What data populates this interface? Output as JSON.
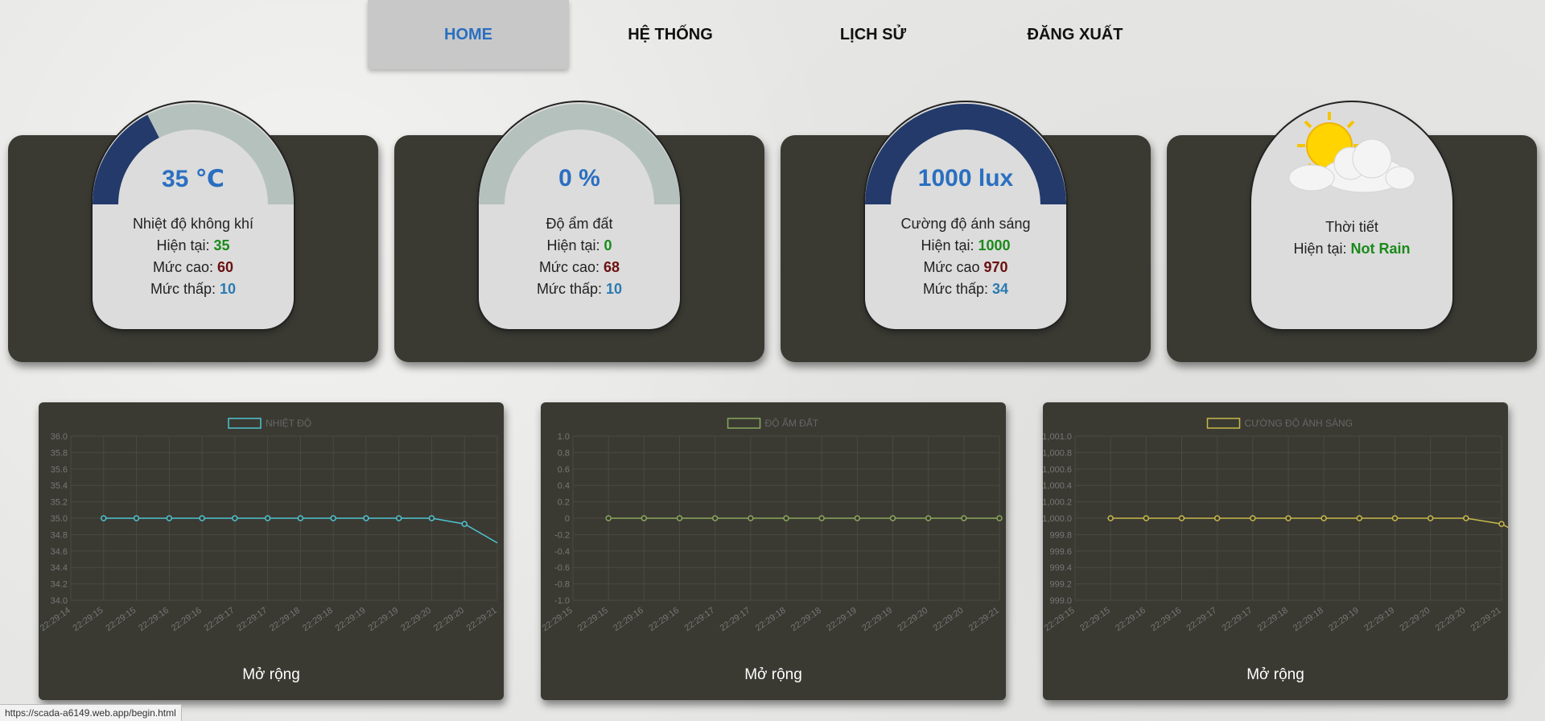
{
  "nav": {
    "items": [
      {
        "label": "HOME",
        "active": true
      },
      {
        "label": "HỆ THỐNG",
        "active": false
      },
      {
        "label": "LỊCH SỬ",
        "active": false
      },
      {
        "label": "ĐĂNG XUẤT",
        "active": false
      }
    ]
  },
  "cards": {
    "temperature": {
      "value_text": "35 ℃",
      "fraction": 0.35,
      "title": "Nhiệt độ không khí",
      "now_label": "Hiện tại: ",
      "now": "35",
      "high_label": "Mức cao: ",
      "high": "60",
      "low_label": "Mức thấp: ",
      "low": "10"
    },
    "soil": {
      "value_text": "0 %",
      "fraction": 0.0,
      "title": "Độ ẩm đất",
      "now_label": "Hiện tại: ",
      "now": "0",
      "high_label": "Mức cao: ",
      "high": "68",
      "low_label": "Mức thấp: ",
      "low": "10"
    },
    "light": {
      "value_text": "1000 lux",
      "fraction": 1.0,
      "title": "Cường độ ánh sáng",
      "now_label": "Hiện tại: ",
      "now": "1000",
      "high_label": "Mức cao ",
      "high": "970",
      "low_label": "Mức thấp: ",
      "low": "34"
    },
    "weather": {
      "title": "Thời tiết",
      "now_label": "Hiện tại: ",
      "now": "Not Rain",
      "icon": "sun-cloud-icon"
    }
  },
  "colors": {
    "gauge_fill": "#233a6b",
    "gauge_track": "#b5c1bd",
    "temp_line": "#4fc3d0",
    "soil_line": "#8aa85a",
    "light_line": "#c8b84a"
  },
  "chart_data": [
    {
      "type": "line",
      "series": [
        {
          "name": "NHIỆT ĐỘ",
          "values": [
            35.0,
            35.0,
            35.0,
            35.0,
            35.0,
            35.0,
            35.0,
            35.0,
            35.0,
            35.0,
            35.0,
            34.93,
            34.7
          ]
        }
      ],
      "x": [
        "22:29:14",
        "22:29:15",
        "22:29:15",
        "22:29:16",
        "22:29:16",
        "22:29:17",
        "22:29:17",
        "22:29:18",
        "22:29:18",
        "22:29:19",
        "22:29:19",
        "22:29:20",
        "22:29:20",
        "22:29:21"
      ],
      "y_ticks": [
        "36.0",
        "35.8",
        "35.6",
        "35.4",
        "35.2",
        "35.0",
        "34.8",
        "34.6",
        "34.4",
        "34.2",
        "34.0"
      ],
      "ylim": [
        34.0,
        36.0
      ],
      "grid": true,
      "legend": "top-center"
    },
    {
      "type": "line",
      "series": [
        {
          "name": "ĐỘ ẨM ĐẤT",
          "values": [
            0,
            0,
            0,
            0,
            0,
            0,
            0,
            0,
            0,
            0,
            0,
            0
          ]
        }
      ],
      "x": [
        "22:29:15",
        "22:29:15",
        "22:29:16",
        "22:29:16",
        "22:29:17",
        "22:29:17",
        "22:29:18",
        "22:29:18",
        "22:29:19",
        "22:29:19",
        "22:29:20",
        "22:29:20",
        "22:29:21"
      ],
      "y_ticks": [
        "1.0",
        "0.8",
        "0.6",
        "0.4",
        "0.2",
        "0",
        "-0.2",
        "-0.4",
        "-0.6",
        "-0.8",
        "-1.0"
      ],
      "ylim": [
        -1.0,
        1.0
      ],
      "grid": true,
      "legend": "top-center"
    },
    {
      "type": "line",
      "series": [
        {
          "name": "CƯỜNG ĐỘ ÁNH SÁNG",
          "values": [
            1000,
            1000,
            1000,
            1000,
            1000,
            1000,
            1000,
            1000,
            1000,
            1000,
            1000,
            999.93,
            999.7
          ]
        }
      ],
      "x": [
        "22:29:15",
        "22:29:15",
        "22:29:16",
        "22:29:16",
        "22:29:17",
        "22:29:17",
        "22:29:18",
        "22:29:18",
        "22:29:19",
        "22:29:19",
        "22:29:20",
        "22:29:20",
        "22:29:21"
      ],
      "y_ticks": [
        "1,001.0",
        "1,000.8",
        "1,000.6",
        "1,000.4",
        "1,000.2",
        "1,000.0",
        "999.8",
        "999.6",
        "999.4",
        "999.2",
        "999.0"
      ],
      "ylim": [
        999.0,
        1001.0
      ],
      "grid": true,
      "legend": "top-center"
    }
  ],
  "expand_label": "Mở rộng",
  "status_url": "https://scada-a6149.web.app/begin.html"
}
